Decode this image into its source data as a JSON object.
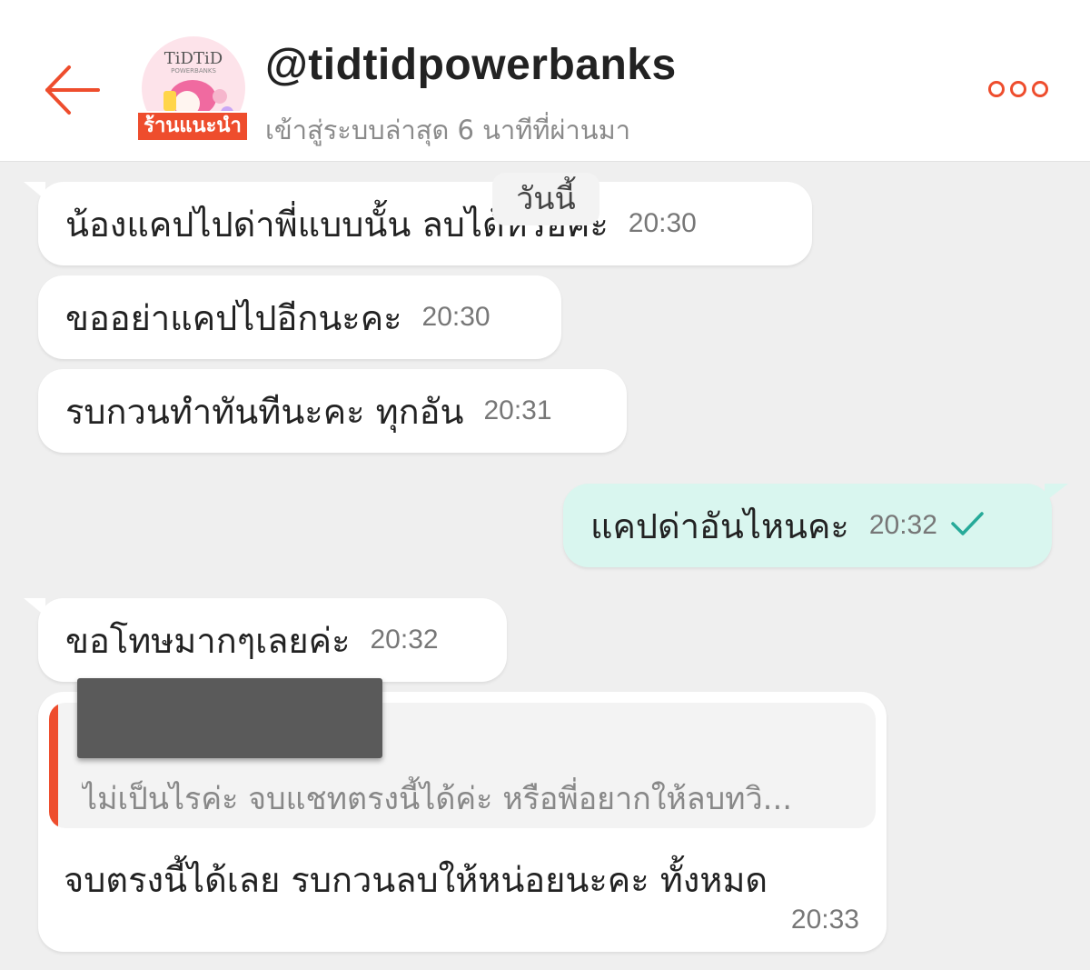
{
  "header": {
    "shop_name": "@tidtidpowerbanks",
    "shop_badge": "ร้านแนะนำ",
    "last_seen": "เข้าสู่ระบบล่าสุด 6 นาทีที่ผ่านมา",
    "avatar_logo_text": "TiDTiD",
    "avatar_logo_sub": "POWERBANKS",
    "accent_color": "#ee4d2d"
  },
  "chat": {
    "date_chip": "วันนี้",
    "messages": [
      {
        "text": "น้องแคปไปด่าพี่แบบนั้น ลบได้หรอคะ",
        "time": "20:30",
        "side": "left"
      },
      {
        "text": "ขออย่าแคปไปอีกนะคะ",
        "time": "20:30",
        "side": "left"
      },
      {
        "text": "รบกวนทำทันทีนะคะ ทุกอัน",
        "time": "20:31",
        "side": "left"
      },
      {
        "text": "แคปด่าอันไหนคะ",
        "time": "20:32",
        "side": "right",
        "status": "sent-check"
      },
      {
        "text": "ขอโทษมากๆเลยค่ะ",
        "time": "20:32",
        "side": "left"
      }
    ],
    "reply": {
      "quoted_text": "ไม่เป็นไรค่ะ จบแชทตรงนี้ได้ค่ะ หรือพี่อยากให้ลบทวิ...",
      "text": "จบตรงนี้ได้เลย  รบกวนลบให้หน่อยนะคะ ทั้งหมด",
      "time": "20:33"
    }
  },
  "colors": {
    "background": "#efefef",
    "bubble_incoming": "#ffffff",
    "bubble_outgoing": "#d9f6ef",
    "check_color": "#26aa99"
  }
}
